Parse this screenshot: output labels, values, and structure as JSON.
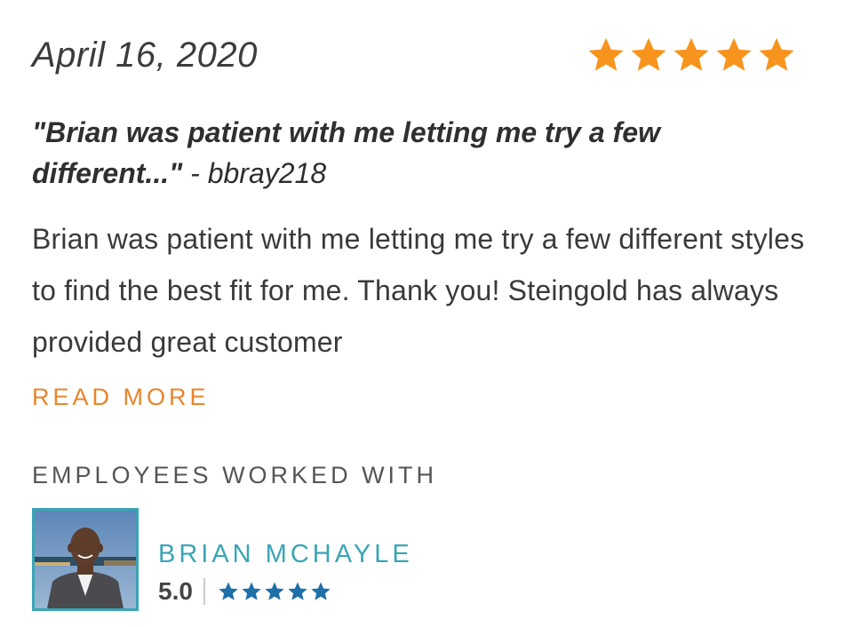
{
  "review": {
    "date": "April 16, 2020",
    "rating": 5,
    "rating_max": 5,
    "star_color": "#f7941d",
    "headline_quote": "\"Brian was patient with me letting me try a few different...\"",
    "headline_author": " - bbray218",
    "body": "Brian was patient with me letting me try a few different styles to find the best fit for me. Thank you! Steingold has always provided great customer",
    "read_more_label": "READ MORE",
    "read_more_color": "#e8842b"
  },
  "employees": {
    "heading": "EMPLOYEES WORKED WITH",
    "items": [
      {
        "name": "BRIAN MCHAYLE",
        "score": "5.0",
        "rating": 5,
        "rating_max": 5,
        "star_color": "#1f6fa8",
        "name_color": "#3aa5b6",
        "photo_icon": "employee-avatar"
      }
    ]
  }
}
